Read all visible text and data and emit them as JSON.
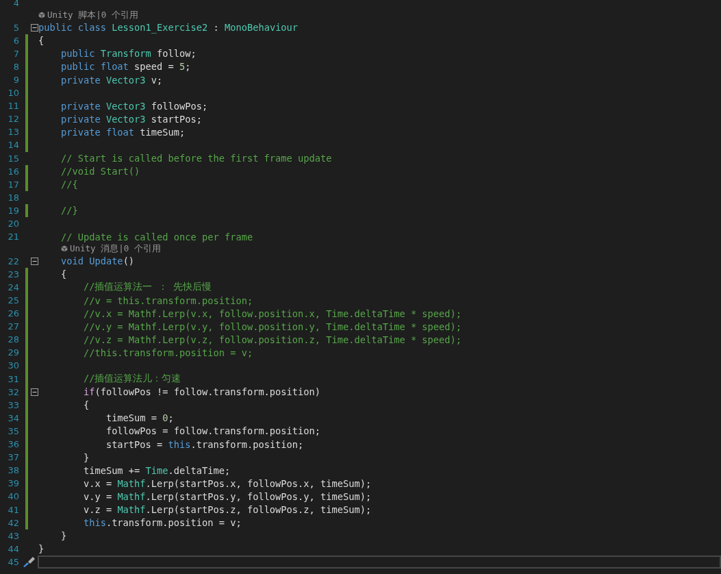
{
  "editor": {
    "lines": [
      {
        "kind": "code",
        "number": "4",
        "changed": false
      },
      {
        "kind": "lens",
        "text": "Unity 脚本|0 个引用"
      },
      {
        "kind": "code",
        "number": "5",
        "changed": false,
        "foldable": true,
        "tokens": [
          {
            "kind": "keyword",
            "text": "public class "
          },
          {
            "kind": "type",
            "text": "Lesson1_Exercise2"
          },
          {
            "kind": "plain",
            "text": " : "
          },
          {
            "kind": "type",
            "text": "MonoBehaviour"
          }
        ]
      },
      {
        "kind": "code",
        "number": "6",
        "changed": true,
        "tokens": [
          {
            "kind": "plain",
            "text": "{"
          }
        ]
      },
      {
        "kind": "code",
        "number": "7",
        "changed": true,
        "tokens": [
          {
            "kind": "keyword",
            "text": "    public "
          },
          {
            "kind": "type",
            "text": "Transform"
          },
          {
            "kind": "plain",
            "text": " follow;"
          }
        ]
      },
      {
        "kind": "code",
        "number": "8",
        "changed": true,
        "tokens": [
          {
            "kind": "keyword",
            "text": "    public float"
          },
          {
            "kind": "plain",
            "text": " speed = "
          },
          {
            "kind": "number",
            "text": "5"
          },
          {
            "kind": "plain",
            "text": ";"
          }
        ]
      },
      {
        "kind": "code",
        "number": "9",
        "changed": true,
        "tokens": [
          {
            "kind": "keyword",
            "text": "    private "
          },
          {
            "kind": "type",
            "text": "Vector3"
          },
          {
            "kind": "plain",
            "text": " v;"
          }
        ]
      },
      {
        "kind": "code",
        "number": "10",
        "changed": true
      },
      {
        "kind": "code",
        "number": "11",
        "changed": true,
        "tokens": [
          {
            "kind": "keyword",
            "text": "    private "
          },
          {
            "kind": "type",
            "text": "Vector3"
          },
          {
            "kind": "plain",
            "text": " followPos;"
          }
        ]
      },
      {
        "kind": "code",
        "number": "12",
        "changed": true,
        "tokens": [
          {
            "kind": "keyword",
            "text": "    private "
          },
          {
            "kind": "type",
            "text": "Vector3"
          },
          {
            "kind": "plain",
            "text": " startPos;"
          }
        ]
      },
      {
        "kind": "code",
        "number": "13",
        "changed": true,
        "tokens": [
          {
            "kind": "keyword",
            "text": "    private float"
          },
          {
            "kind": "plain",
            "text": " timeSum;"
          }
        ]
      },
      {
        "kind": "code",
        "number": "14",
        "changed": true
      },
      {
        "kind": "code",
        "number": "15",
        "changed": false,
        "tokens": [
          {
            "kind": "comment",
            "text": "    // Start is called before the first frame update"
          }
        ]
      },
      {
        "kind": "code",
        "number": "16",
        "changed": true,
        "tokens": [
          {
            "kind": "comment",
            "text": "    //void Start()"
          }
        ]
      },
      {
        "kind": "code",
        "number": "17",
        "changed": true,
        "tokens": [
          {
            "kind": "comment",
            "text": "    //{"
          }
        ]
      },
      {
        "kind": "code",
        "number": "18",
        "changed": false
      },
      {
        "kind": "code",
        "number": "19",
        "changed": true,
        "tokens": [
          {
            "kind": "comment",
            "text": "    //}"
          }
        ]
      },
      {
        "kind": "code",
        "number": "20",
        "changed": false
      },
      {
        "kind": "code",
        "number": "21",
        "changed": false,
        "tokens": [
          {
            "kind": "comment",
            "text": "    // Update is called once per frame"
          }
        ]
      },
      {
        "kind": "lens",
        "text": "Unity 消息|0 个引用"
      },
      {
        "kind": "code",
        "number": "22",
        "changed": false,
        "foldable": true,
        "tokens": [
          {
            "kind": "keyword",
            "text": "    void "
          },
          {
            "kind": "method",
            "text": "Update"
          },
          {
            "kind": "plain",
            "text": "()"
          }
        ]
      },
      {
        "kind": "code",
        "number": "23",
        "changed": true,
        "tokens": [
          {
            "kind": "plain",
            "text": "    {"
          }
        ]
      },
      {
        "kind": "code",
        "number": "24",
        "changed": true,
        "tokens": [
          {
            "kind": "comment",
            "text": "        //插值运算法一 ： 先快后慢"
          }
        ]
      },
      {
        "kind": "code",
        "number": "25",
        "changed": true,
        "tokens": [
          {
            "kind": "comment",
            "text": "        //v = this.transform.position;"
          }
        ]
      },
      {
        "kind": "code",
        "number": "26",
        "changed": true,
        "tokens": [
          {
            "kind": "comment",
            "text": "        //v.x = Mathf.Lerp(v.x, follow.position.x, Time.deltaTime * speed);"
          }
        ]
      },
      {
        "kind": "code",
        "number": "27",
        "changed": true,
        "tokens": [
          {
            "kind": "comment",
            "text": "        //v.y = Mathf.Lerp(v.y, follow.position.y, Time.deltaTime * speed);"
          }
        ]
      },
      {
        "kind": "code",
        "number": "28",
        "changed": true,
        "tokens": [
          {
            "kind": "comment",
            "text": "        //v.z = Mathf.Lerp(v.z, follow.position.z, Time.deltaTime * speed);"
          }
        ]
      },
      {
        "kind": "code",
        "number": "29",
        "changed": true,
        "tokens": [
          {
            "kind": "comment",
            "text": "        //this.transform.position = v;"
          }
        ]
      },
      {
        "kind": "code",
        "number": "30",
        "changed": true
      },
      {
        "kind": "code",
        "number": "31",
        "changed": true,
        "tokens": [
          {
            "kind": "comment",
            "text": "        //插值运算法儿：匀速"
          }
        ]
      },
      {
        "kind": "code",
        "number": "32",
        "changed": true,
        "foldable": true,
        "tokens": [
          {
            "kind": "control",
            "text": "        if"
          },
          {
            "kind": "plain",
            "text": "(followPos != follow.transform.position)"
          }
        ]
      },
      {
        "kind": "code",
        "number": "33",
        "changed": true,
        "tokens": [
          {
            "kind": "plain",
            "text": "        {"
          }
        ]
      },
      {
        "kind": "code",
        "number": "34",
        "changed": true,
        "tokens": [
          {
            "kind": "plain",
            "text": "            timeSum = "
          },
          {
            "kind": "number",
            "text": "0"
          },
          {
            "kind": "plain",
            "text": ";"
          }
        ]
      },
      {
        "kind": "code",
        "number": "35",
        "changed": true,
        "tokens": [
          {
            "kind": "plain",
            "text": "            followPos = follow.transform.position;"
          }
        ]
      },
      {
        "kind": "code",
        "number": "36",
        "changed": true,
        "tokens": [
          {
            "kind": "plain",
            "text": "            startPos = "
          },
          {
            "kind": "keyword",
            "text": "this"
          },
          {
            "kind": "plain",
            "text": ".transform.position;"
          }
        ]
      },
      {
        "kind": "code",
        "number": "37",
        "changed": true,
        "tokens": [
          {
            "kind": "plain",
            "text": "        }"
          }
        ]
      },
      {
        "kind": "code",
        "number": "38",
        "changed": true,
        "tokens": [
          {
            "kind": "plain",
            "text": "        timeSum += "
          },
          {
            "kind": "type",
            "text": "Time"
          },
          {
            "kind": "plain",
            "text": ".deltaTime;"
          }
        ]
      },
      {
        "kind": "code",
        "number": "39",
        "changed": true,
        "tokens": [
          {
            "kind": "plain",
            "text": "        v.x = "
          },
          {
            "kind": "type",
            "text": "Mathf"
          },
          {
            "kind": "plain",
            "text": ".Lerp(startPos.x, followPos.x, timeSum);"
          }
        ]
      },
      {
        "kind": "code",
        "number": "40",
        "changed": true,
        "tokens": [
          {
            "kind": "plain",
            "text": "        v.y = "
          },
          {
            "kind": "type",
            "text": "Mathf"
          },
          {
            "kind": "plain",
            "text": ".Lerp(startPos.y, followPos.y, timeSum);"
          }
        ]
      },
      {
        "kind": "code",
        "number": "41",
        "changed": true,
        "tokens": [
          {
            "kind": "plain",
            "text": "        v.z = "
          },
          {
            "kind": "type",
            "text": "Mathf"
          },
          {
            "kind": "plain",
            "text": ".Lerp(startPos.z, followPos.z, timeSum);"
          }
        ]
      },
      {
        "kind": "code",
        "number": "42",
        "changed": true,
        "tokens": [
          {
            "kind": "keyword",
            "text": "        this"
          },
          {
            "kind": "plain",
            "text": ".transform.position = v;"
          }
        ]
      },
      {
        "kind": "code",
        "number": "43",
        "changed": false,
        "tokens": [
          {
            "kind": "plain",
            "text": "    }"
          }
        ]
      },
      {
        "kind": "code",
        "number": "44",
        "changed": false,
        "tokens": [
          {
            "kind": "plain",
            "text": "}"
          }
        ]
      },
      {
        "kind": "code",
        "number": "45",
        "changed": false,
        "current": true
      }
    ]
  }
}
